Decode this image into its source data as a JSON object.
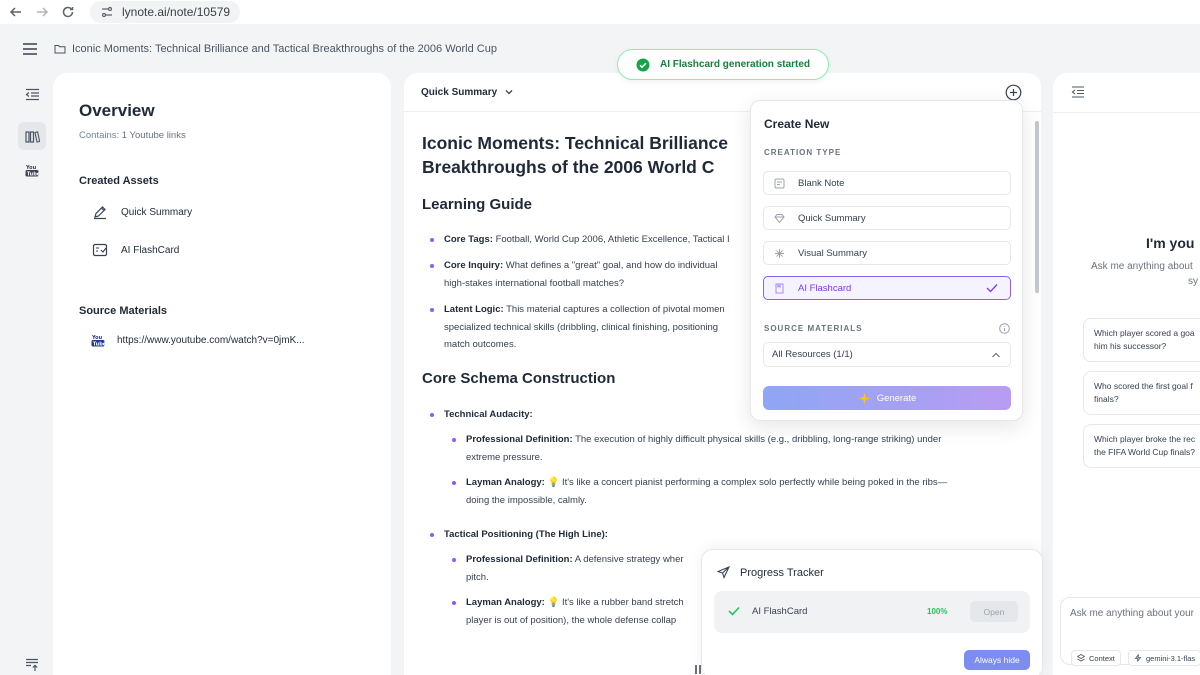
{
  "browser": {
    "url": "lynote.ai/note/10579"
  },
  "header": {
    "note_title": "Iconic Moments: Technical Brilliance and Tactical Breakthroughs of the 2006 World Cup"
  },
  "toast": {
    "text": "AI Flashcard generation started",
    "color": "#15803d"
  },
  "sidebar": {
    "title": "Overview",
    "contains_label": "Contains:",
    "contains_value": "1 Youtube links",
    "created_assets_title": "Created Assets",
    "assets": [
      {
        "label": "Quick Summary",
        "icon": "pen-icon"
      },
      {
        "label": "AI FlashCard",
        "icon": "flashcard-icon"
      }
    ],
    "source_title": "Source Materials",
    "sources": [
      {
        "label": "https://www.youtube.com/watch?v=0jmK...",
        "icon": "youtube-icon"
      }
    ]
  },
  "main": {
    "view_selector": "Quick Summary",
    "doc_title_line1": "Iconic Moments: Technical Brilliance",
    "doc_title_line2": "Breakthroughs of the 2006 World C",
    "learning_guide_heading": "Learning Guide",
    "core_tags_label": "Core Tags:",
    "core_tags_text": "Football, World Cup 2006, Athletic Excellence, Tactical I",
    "core_inquiry_label": "Core Inquiry:",
    "core_inquiry_text1": "What defines a \"great\" goal, and how do individual",
    "core_inquiry_text2": "high-stakes international football matches?",
    "latent_logic_label": "Latent Logic:",
    "latent_logic_text1": "This material captures a collection of pivotal momen",
    "latent_logic_text2": "specialized technical skills (dribbling, clinical finishing, positioning",
    "latent_logic_text3": "match outcomes.",
    "schema_heading": "Core Schema Construction",
    "tech_audacity": "Technical Audacity:",
    "prof_def_label": "Professional Definition:",
    "tech_prof_def1": "The execution of highly difficult physical skills (e.g., dribbling, long-range striking) under",
    "tech_prof_def2": "extreme pressure.",
    "layman_label": "Layman Analogy:",
    "tech_layman1": "It's like a concert pianist performing a complex solo perfectly while being poked in the ribs—",
    "tech_layman2": "doing the impossible, calmly.",
    "tactical_positioning": "Tactical Positioning (The High Line):",
    "tact_prof_def1": "A defensive strategy wher",
    "tact_prof_def2": "pitch.",
    "tact_layman1": "It's like a rubber band stretch",
    "tact_layman2": "player is out of position), the whole defense collap"
  },
  "create_new": {
    "title": "Create New",
    "creation_type_label": "CREATION TYPE",
    "options": [
      {
        "label": "Blank Note",
        "icon": "note-icon",
        "selected": false
      },
      {
        "label": "Quick Summary",
        "icon": "diamond-icon",
        "selected": false
      },
      {
        "label": "Visual Summary",
        "icon": "sparkle-icon",
        "selected": false
      },
      {
        "label": "AI Flashcard",
        "icon": "flashcard-icon",
        "selected": true
      }
    ],
    "source_materials_label": "SOURCE MATERIALS",
    "resources_value": "All Resources (1/1)",
    "generate_label": "Generate",
    "accent": "#8b5cf6"
  },
  "progress": {
    "title": "Progress Tracker",
    "item_label": "AI FlashCard",
    "percent": "100%",
    "open_label": "Open",
    "always_hide_label": "Always hide"
  },
  "chat": {
    "greeting": "I'm you",
    "sub1": "Ask me anything about",
    "sub2": "sy",
    "suggestions": [
      {
        "line1": "Which player scored a goa",
        "line2": "him his successor?"
      },
      {
        "line1": "Who scored the first goal f",
        "line2": "finals?"
      },
      {
        "line1": "Which player broke the rec",
        "line2": "the FIFA World Cup finals?"
      }
    ],
    "input_placeholder": "Ask me anything about your",
    "context_chip": "Context",
    "model_chip": "gemini-3.1-flas"
  }
}
